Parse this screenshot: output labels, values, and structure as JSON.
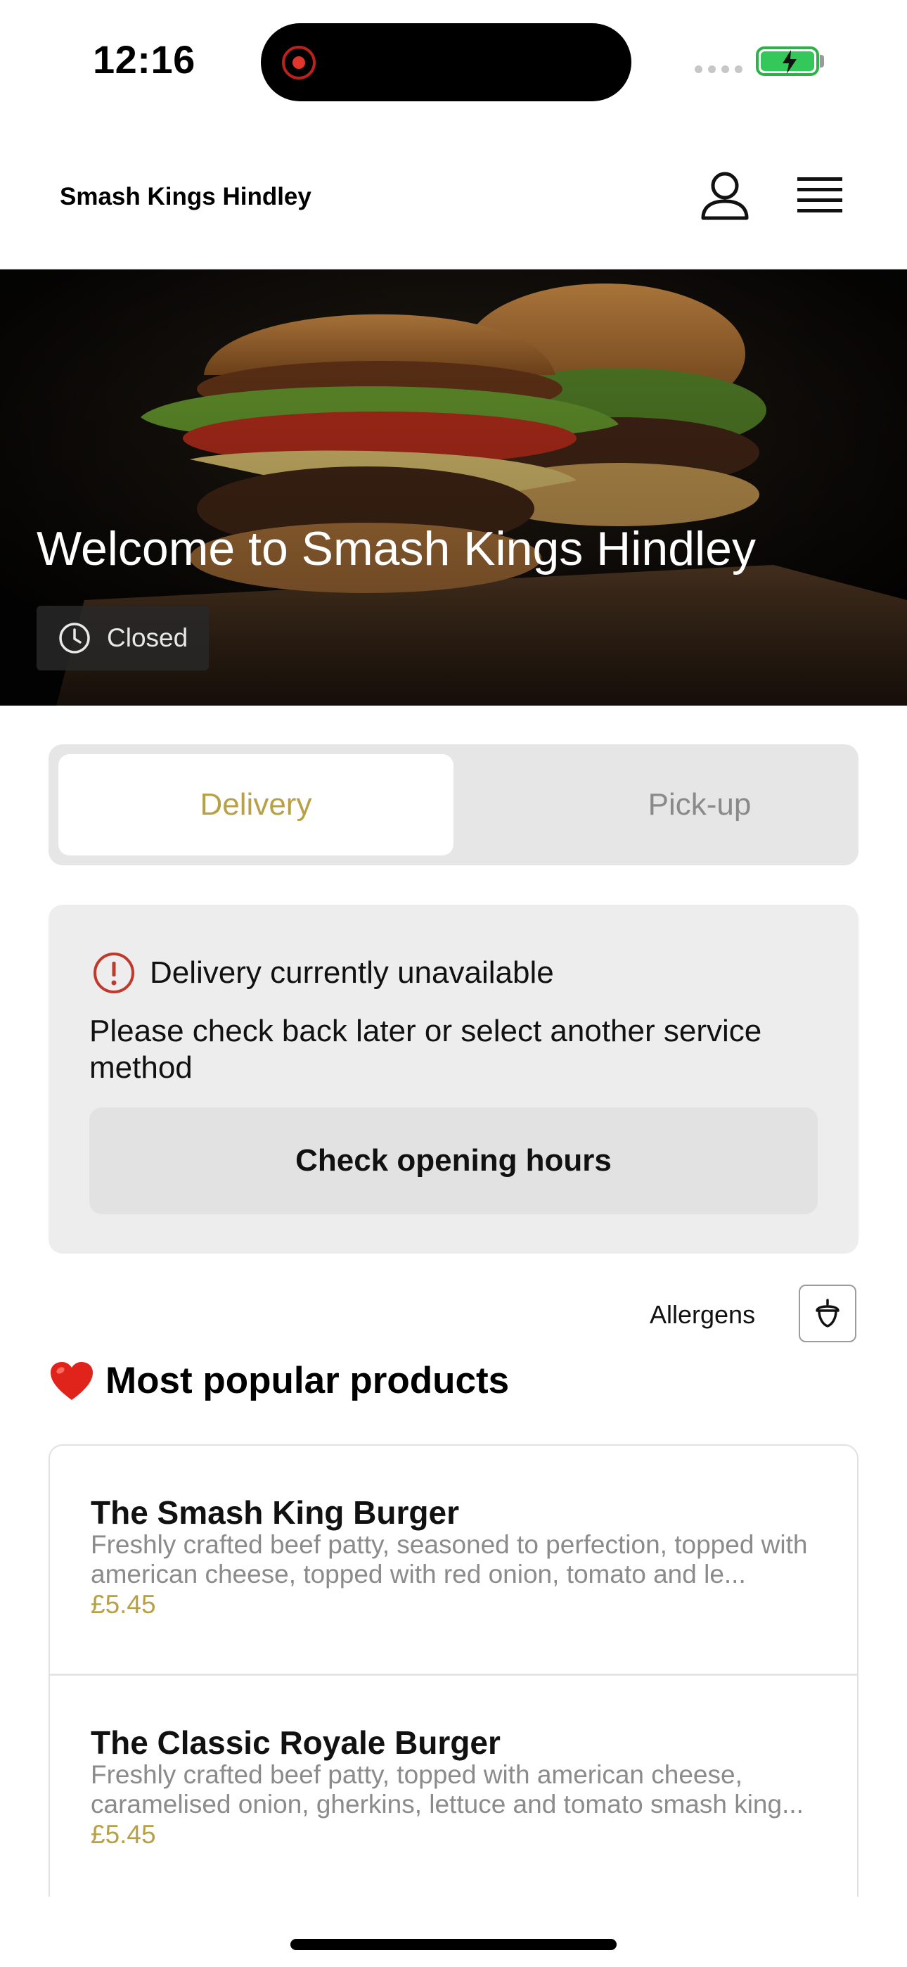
{
  "status_bar": {
    "time": "12:16",
    "battery_charging": true
  },
  "header": {
    "brand": "Smash Kings Hindley",
    "icons": [
      "user-icon",
      "menu-icon"
    ]
  },
  "hero": {
    "title": "Welcome to Smash Kings Hindley",
    "status_label": "Closed",
    "status_icon": "clock-icon"
  },
  "service_toggle": {
    "options": [
      "Delivery",
      "Pick-up"
    ],
    "selected": "Delivery"
  },
  "notice": {
    "icon": "info-icon",
    "title": "Delivery currently unavailable",
    "body": "Please check back later or select another service method",
    "button_label": "Check opening hours"
  },
  "allergens": {
    "label": "Allergens",
    "icon": "acorn-icon"
  },
  "popular": {
    "emoji": "❤️",
    "title": "Most popular products",
    "products": [
      {
        "name": "The Smash King Burger",
        "description": "Freshly crafted beef patty, seasoned to perfection, topped with american cheese, topped with red onion, tomato and le...",
        "price": "£5.45"
      },
      {
        "name": "The Classic Royale Burger",
        "description": "Freshly crafted beef patty, topped with american cheese, caramelised onion, gherkins, lettuce and tomato smash king...",
        "price": "£5.45"
      }
    ]
  },
  "colors": {
    "accent": "#b8a047",
    "alert": "#c0392b",
    "card_bg": "#ededed",
    "toggle_bg": "#e6e6e6"
  }
}
